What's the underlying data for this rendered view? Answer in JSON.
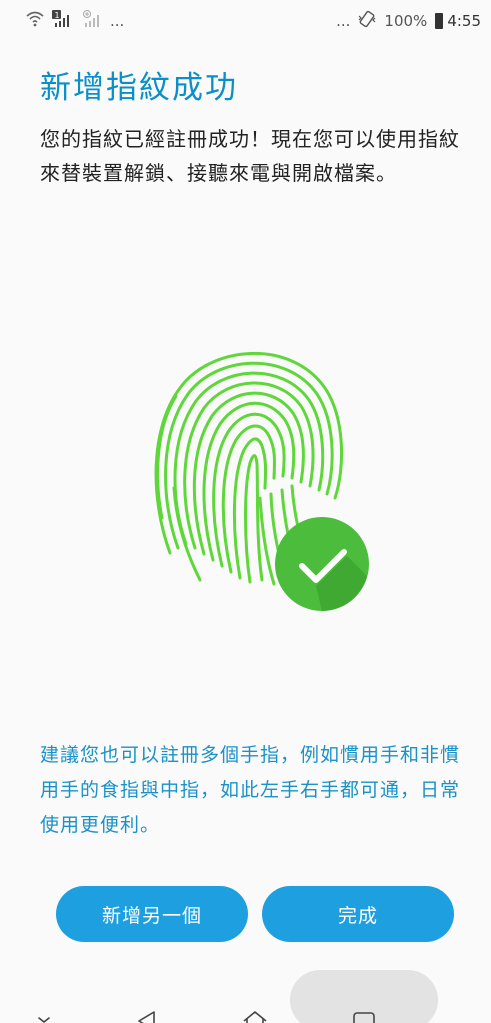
{
  "status_bar": {
    "left_ellipsis": "...",
    "sim_badge": "1",
    "right_ellipsis": "...",
    "battery_percent": "100%",
    "time": "4:55"
  },
  "page": {
    "title": "新增指紋成功",
    "description": "您的指紋已經註冊成功！現在您可以使用指紋來替裝置解鎖、接聽來電與開啟檔案。",
    "hint": "建議您也可以註冊多個手指，例如慣用手和非慣用手的食指與中指，如此左手右手都可通，日常使用更便利。"
  },
  "buttons": {
    "add_another": "新增另一個",
    "done": "完成"
  },
  "icons": {
    "fingerprint": "fingerprint-icon",
    "success_check": "check-circle-icon"
  },
  "colors": {
    "accent_blue": "#1ea0e0",
    "title_blue": "#0a8fc8",
    "fingerprint_green": "#5fd63a",
    "check_green": "#4cbc3c"
  }
}
